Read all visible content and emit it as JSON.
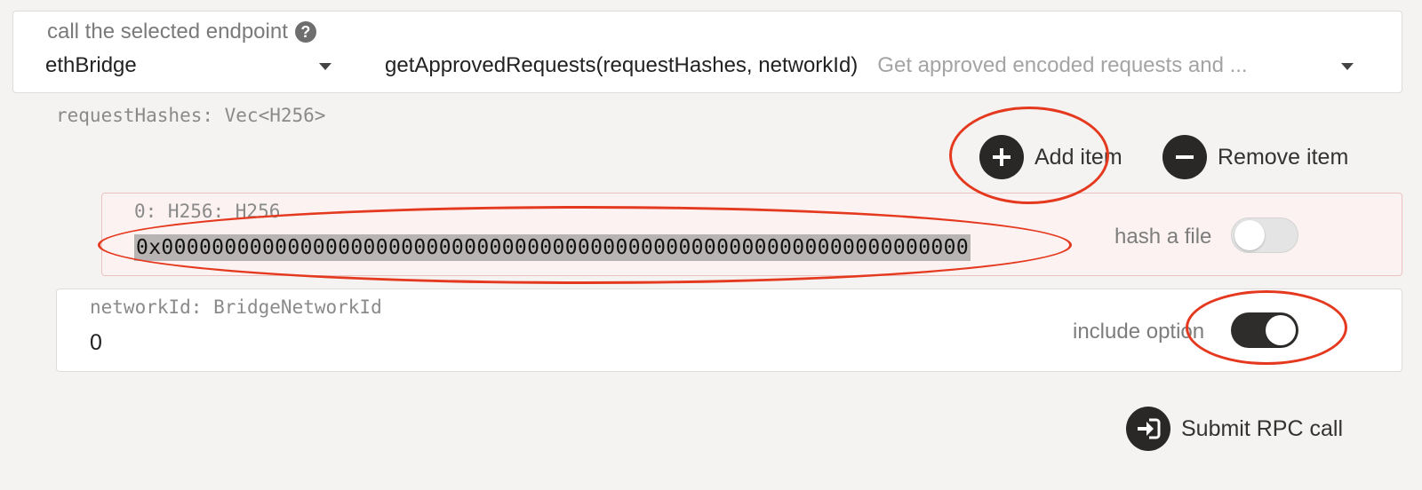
{
  "endpoint": {
    "label": "call the selected endpoint",
    "help_icon": "?",
    "section": "ethBridge",
    "method": "getApprovedRequests(requestHashes, networkId)",
    "description": "Get approved encoded requests and ..."
  },
  "params": {
    "request_hashes_label": "requestHashes: Vec<H256>",
    "add_item": "Add item",
    "remove_item": "Remove item",
    "item_label": "0: H256: H256",
    "item_value": "0x0000000000000000000000000000000000000000000000000000000000000000",
    "hash_file_label": "hash a file",
    "hash_file_enabled": false,
    "network_label": "networkId: BridgeNetworkId",
    "network_value": "0",
    "include_option_label": "include option",
    "include_option_enabled": true
  },
  "submit_label": "Submit RPC call",
  "icons": {
    "help": "question-circle-icon",
    "add": "plus-circle-icon",
    "remove": "minus-circle-icon",
    "caret": "caret-down-icon",
    "submit": "sign-in-icon"
  },
  "colors": {
    "annotation": "#e5391f",
    "icon_bg": "#2a2826",
    "item_bg": "#fbf2f1",
    "toggle_on": "#2f2d2b"
  }
}
